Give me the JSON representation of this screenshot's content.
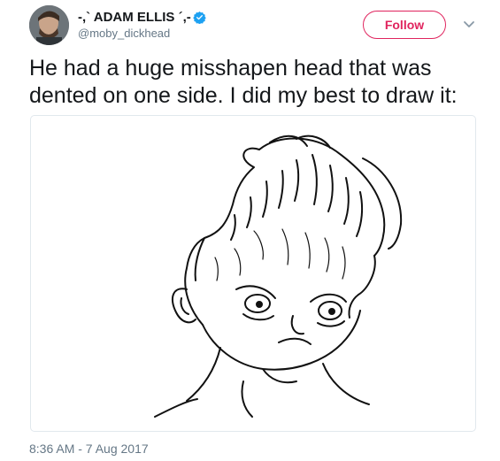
{
  "author": {
    "display_name": "-,` ADAM ELLIS ´,-",
    "handle": "@moby_dickhead",
    "verified": true
  },
  "actions": {
    "follow_label": "Follow",
    "menu_icon": "chevron-down-icon"
  },
  "tweet": {
    "text_line1": "He had a huge misshapen head that was",
    "text_line2": "dented on one side. I did my best to draw it:"
  },
  "timestamp": "8:36 AM - 7 Aug 2017",
  "colors": {
    "follow_accent": "#e0245e",
    "verified_blue": "#1da1f2",
    "secondary_text": "#657786"
  }
}
